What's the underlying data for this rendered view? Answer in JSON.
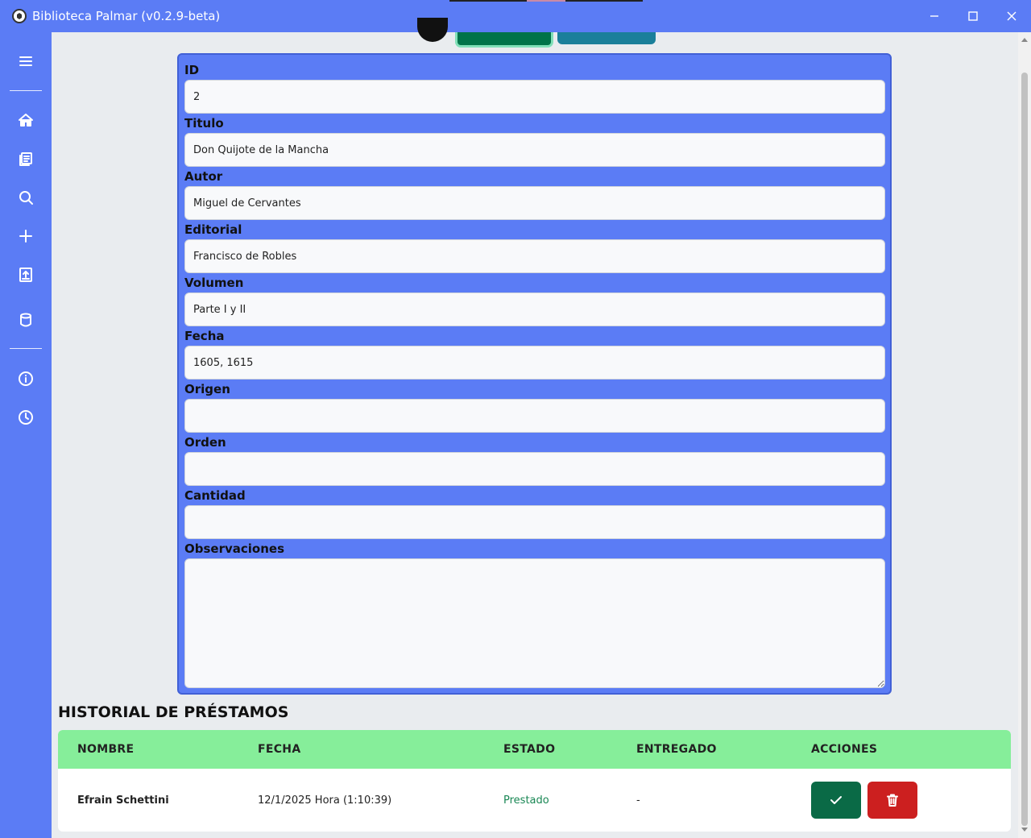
{
  "window": {
    "title": "Biblioteca Palmar (v0.2.9-beta)"
  },
  "sidebar": {
    "items": [
      {
        "icon": "menu-icon"
      },
      {
        "icon": "home-icon"
      },
      {
        "icon": "books-icon"
      },
      {
        "icon": "search-icon"
      },
      {
        "icon": "plus-icon"
      },
      {
        "icon": "upload-icon"
      },
      {
        "icon": "database-icon"
      },
      {
        "icon": "info-icon"
      },
      {
        "icon": "clock-icon"
      }
    ]
  },
  "form": {
    "fields": [
      {
        "label": "ID",
        "value": "2"
      },
      {
        "label": "Titulo",
        "value": "Don Quijote de la Mancha"
      },
      {
        "label": "Autor",
        "value": "Miguel de Cervantes"
      },
      {
        "label": "Editorial",
        "value": "Francisco de Robles"
      },
      {
        "label": "Volumen",
        "value": "Parte I y II"
      },
      {
        "label": "Fecha",
        "value": "1605, 1615"
      },
      {
        "label": "Origen",
        "value": ""
      },
      {
        "label": "Orden",
        "value": ""
      },
      {
        "label": "Cantidad",
        "value": ""
      }
    ],
    "observaciones": {
      "label": "Observaciones",
      "value": ""
    }
  },
  "history": {
    "title": "HISTORIAL DE PRÉSTAMOS",
    "columns": [
      "NOMBRE",
      "FECHA",
      "ESTADO",
      "ENTREGADO",
      "ACCIONES"
    ],
    "rows": [
      {
        "nombre": "Efrain Schettini",
        "fecha": "12/1/2025 Hora (1:10:39)",
        "estado": "Prestado",
        "entregado": "-"
      }
    ]
  },
  "colors": {
    "primary": "#5b7cf5",
    "success": "#0a6a46",
    "danger": "#cc1f1f",
    "table_header": "#86ee9a"
  }
}
